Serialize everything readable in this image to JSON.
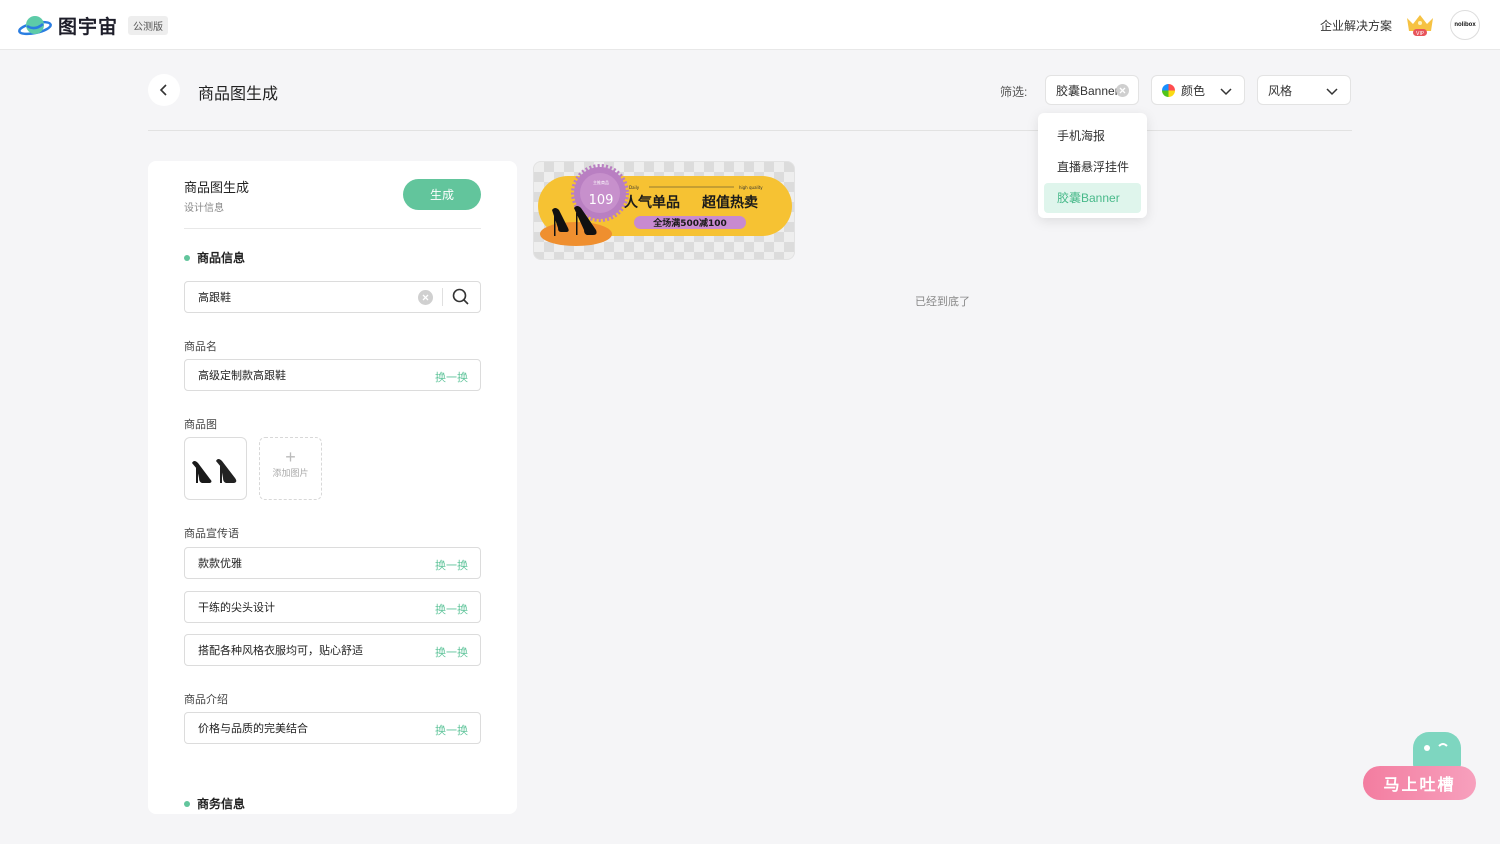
{
  "app": {
    "name": "图宇宙",
    "badge": "公测版",
    "enterprise": "企业解决方案",
    "avatar_text": "nolibox",
    "vip_text": "VIP"
  },
  "header": {
    "title": "商品图生成",
    "filter_label": "筛选:",
    "type_chip": "胶囊Banner",
    "color_chip": "颜色",
    "style_chip": "风格"
  },
  "dropdown": {
    "items": [
      {
        "label": "手机海报",
        "selected": false
      },
      {
        "label": "直播悬浮挂件",
        "selected": false
      },
      {
        "label": "胶囊Banner",
        "selected": true
      }
    ]
  },
  "panel": {
    "title": "商品图生成",
    "subtitle": "设计信息",
    "generate": "生成",
    "section_product": "商品信息",
    "search_value": "高跟鞋",
    "name_label": "商品名",
    "name_value": "高级定制款高跟鞋",
    "swap": "换一换",
    "image_label": "商品图",
    "add_image": "添加图片",
    "slogan_label": "商品宣传语",
    "slogans": [
      "款款优雅",
      "干练的尖头设计",
      "搭配各种风格衣服均可，贴心舒适"
    ],
    "intro_label": "商品介绍",
    "intro_value": "价格与品质的完美结合",
    "section_business": "商务信息"
  },
  "banner": {
    "badge_date": "109",
    "daily": "Daily",
    "quality": "high quality",
    "headline_a": "人气单品",
    "headline_b": "超值热卖",
    "promo": "全场满500减100",
    "tag": "主推商品"
  },
  "results": {
    "end_text": "已经到底了"
  },
  "feedback": {
    "label": "马上吐槽"
  },
  "colors": {
    "accent": "#62c59c",
    "accent_light": "#dff5ec",
    "banner_yellow": "#f6c233",
    "banner_purple": "#b97fc2",
    "feedback_pink": "#f37da0"
  }
}
